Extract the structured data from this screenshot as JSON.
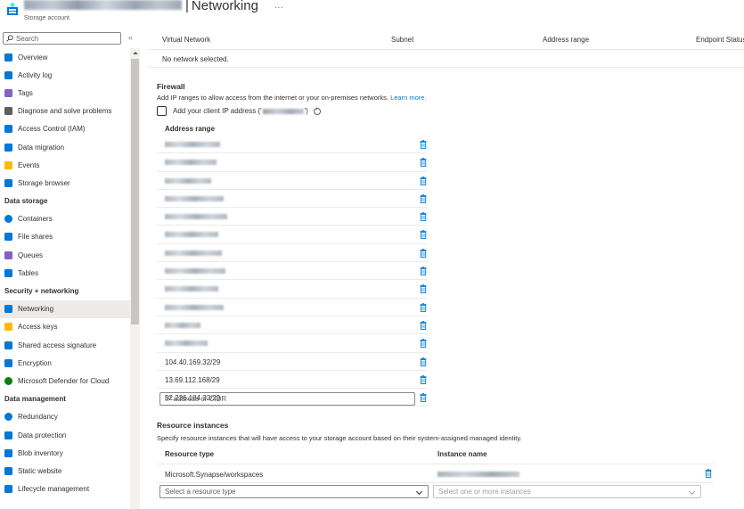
{
  "header": {
    "title_separator": "|",
    "title": "Networking",
    "more": "···",
    "subtitle": "Storage account"
  },
  "sidebar": {
    "search_placeholder": "Search",
    "collapse": "«",
    "groups": [
      {
        "section": "",
        "items": [
          {
            "label": "Overview",
            "icon": "overview-icon",
            "color": "#0078d4"
          },
          {
            "label": "Activity log",
            "icon": "activity-log-icon",
            "color": "#0078d4"
          },
          {
            "label": "Tags",
            "icon": "tag-icon",
            "color": "#8661c5"
          },
          {
            "label": "Diagnose and solve problems",
            "icon": "wrench-icon",
            "color": "#605e5c"
          },
          {
            "label": "Access Control (IAM)",
            "icon": "iam-icon",
            "color": "#0078d4"
          },
          {
            "label": "Data migration",
            "icon": "data-migration-icon",
            "color": "#0078d4"
          },
          {
            "label": "Events",
            "icon": "lightning-icon",
            "color": "#ffb900"
          },
          {
            "label": "Storage browser",
            "icon": "folder-icon",
            "color": "#0078d4"
          }
        ]
      },
      {
        "section": "Data storage",
        "items": [
          {
            "label": "Containers",
            "icon": "container-icon",
            "color": "#0078d4"
          },
          {
            "label": "File shares",
            "icon": "file-share-icon",
            "color": "#0078d4"
          },
          {
            "label": "Queues",
            "icon": "queue-icon",
            "color": "#8661c5"
          },
          {
            "label": "Tables",
            "icon": "table-icon",
            "color": "#0078d4"
          }
        ]
      },
      {
        "section": "Security + networking",
        "items": [
          {
            "label": "Networking",
            "icon": "networking-icon",
            "color": "#0078d4",
            "active": true
          },
          {
            "label": "Access keys",
            "icon": "key-icon",
            "color": "#ffb900"
          },
          {
            "label": "Shared access signature",
            "icon": "link-icon",
            "color": "#0078d4"
          },
          {
            "label": "Encryption",
            "icon": "lock-icon",
            "color": "#0078d4"
          },
          {
            "label": "Microsoft Defender for Cloud",
            "icon": "shield-icon",
            "color": "#107c10"
          }
        ]
      },
      {
        "section": "Data management",
        "items": [
          {
            "label": "Redundancy",
            "icon": "globe-icon",
            "color": "#0078d4"
          },
          {
            "label": "Data protection",
            "icon": "data-protection-icon",
            "color": "#0078d4"
          },
          {
            "label": "Blob inventory",
            "icon": "inventory-icon",
            "color": "#0078d4"
          },
          {
            "label": "Static website",
            "icon": "website-icon",
            "color": "#0078d4"
          },
          {
            "label": "Lifecycle management",
            "icon": "lifecycle-icon",
            "color": "#0078d4"
          }
        ]
      }
    ]
  },
  "vnet": {
    "columns": [
      "Virtual Network",
      "Subnet",
      "Address range",
      "Endpoint Status"
    ],
    "empty_text": "No network selected."
  },
  "firewall": {
    "title": "Firewall",
    "description": "Add IP ranges to allow access from the internet or your on-premises networks.",
    "learn_more": "Learn more.",
    "checkbox_prefix": "Add your client IP address ('",
    "checkbox_suffix": "')",
    "column_header": "Address range",
    "visible_ranges": [
      "104.40.169.32/29",
      "13.69.112.168/29",
      "52.236.184.32/29"
    ],
    "input_placeholder": "IP address or CIDR"
  },
  "resource_instances": {
    "title": "Resource instances",
    "description": "Specify resource instances that will have access to your storage account based on their system-assigned managed identity.",
    "columns": [
      "Resource type",
      "Instance name"
    ],
    "row_type": "Microsoft.Synapse/workspaces",
    "type_placeholder": "Select a resource type",
    "instance_placeholder": "Select one or more instances"
  }
}
